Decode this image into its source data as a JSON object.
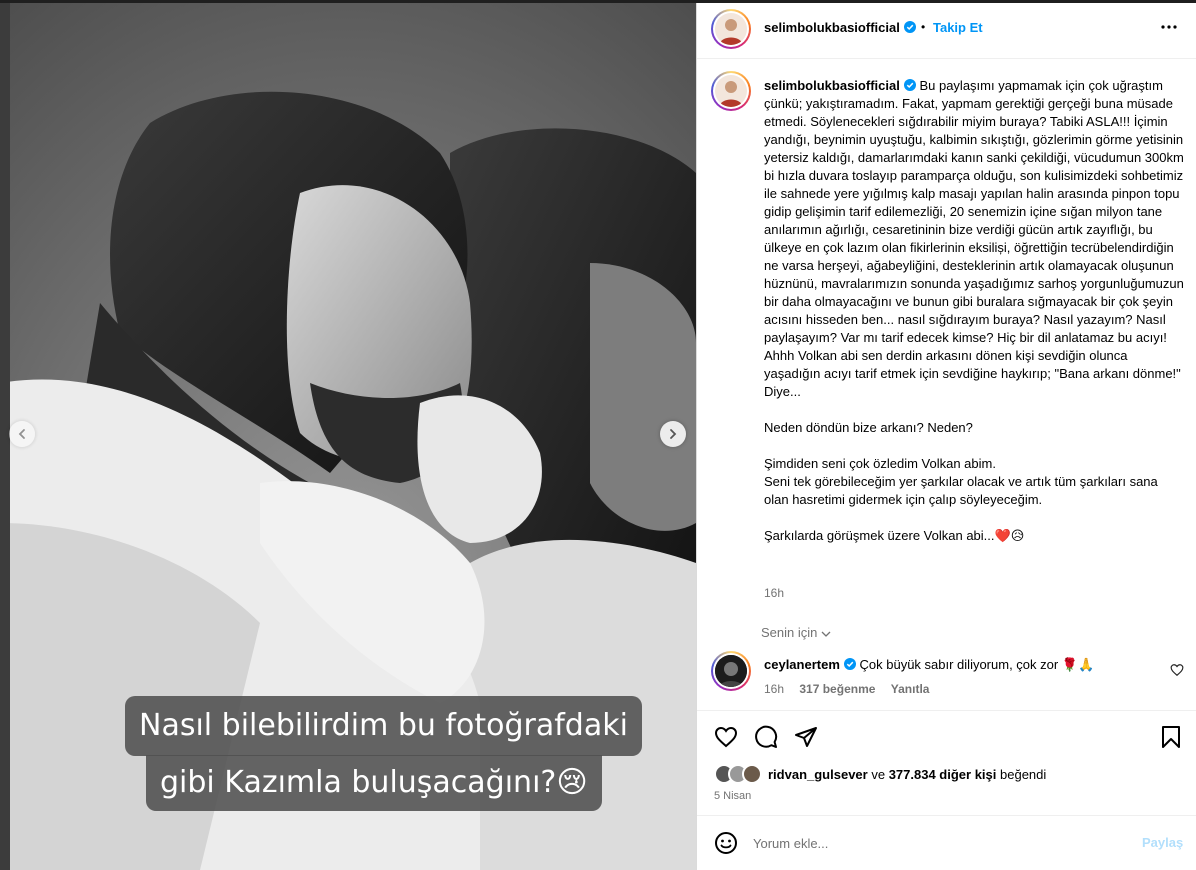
{
  "post": {
    "username": "selimbolukbasiofficial",
    "follow_dot": "•",
    "follow_label": "Takip Et",
    "more_icon": "more-horizontal-icon",
    "image_caption_line1": "Nasıl bilebilirdim bu fotoğrafdaki",
    "image_caption_line2": "gibi Kazımla buluşacağını?😢",
    "caption_text": "Bu paylaşımı yapmamak için çok uğraştım çünkü; yakıştıramadım. Fakat, yapmam gerektiği gerçeği buna müsade etmedi. Söylenecekleri sığdırabilir miyim buraya? Tabiki ASLA!!! İçimin yandığı, beynimin uyuştuğu, kalbimin sıkıştığı, gözlerimin görme yetisinin yetersiz kaldığı, damarlarımdaki kanın sanki çekildiği, vücudumun 300km bi hızla duvara toslayıp paramparça olduğu, son kulisimizdeki sohbetimiz ile sahnede yere yığılmış kalp masajı yapılan halin arasında pinpon topu gidip gelişimin tarif edilemezliği, 20 senemizin içine sığan milyon tane anılarımın ağırlığı, cesaretininin bize verdiği gücün artık zayıflığı, bu ülkeye en çok lazım olan fikirlerinin eksiliși, öğrettiğin tecrübelendirdiğin ne varsa herşeyi, ağabeyliğini, desteklerinin artık olamayacak oluşunun hüznünü, mavralarımızın sonunda yaşadığımız sarhoş yorgunluğumuzun bir daha olmayacağını ve bunun gibi buralara sığmayacak bir çok şeyin acısını hisseden ben... nasıl sığdırayım buraya? Nasıl yazayım? Nasıl paylaşayım? Var mı tarif edecek kimse? Hiç bir dil anlatamaz bu acıyı! Ahhh Volkan abi sen derdin arkasını dönen kişi sevdiğin olunca yaşadığın acıyı tarif etmek için sevdiğine haykırıp; \"Bana arkanı dönme!\" Diye...\n\nNeden döndün bize arkanı? Neden?\n\nŞimdiden seni çok özledim Volkan abim.\nSeni tek görebileceğim yer şarkılar olacak ve artık tüm şarkıları sana olan hasretimi gidermek için çalıp söyleyeceğim.\n\nŞarkılarda görüşmek üzere Volkan abi...❤️😥",
    "caption_time": "16h",
    "translate_label": "Senin için",
    "comment": {
      "username": "ceylanertem",
      "text": "Çok büyük sabır diliyorum, çok zor 🌹🙏",
      "time": "16h",
      "likes": "317 beğenme",
      "reply_label": "Yanıtla"
    },
    "actions": {
      "like_icon": "heart-icon",
      "comment_icon": "comment-icon",
      "share_icon": "share-icon",
      "save_icon": "bookmark-icon"
    },
    "liked_by_user": "ridvan_gulsever",
    "liked_connector": "ve",
    "liked_count": "377.834 diğer kişi",
    "liked_suffix": "beğendi",
    "date": "5 Nisan",
    "comment_placeholder": "Yorum ekle...",
    "post_button_label": "Paylaş"
  },
  "colors": {
    "accent": "#0095f6",
    "post_button_disabled": "#b2dffc",
    "secondary_text": "#737373",
    "verified": "#0095f6"
  }
}
